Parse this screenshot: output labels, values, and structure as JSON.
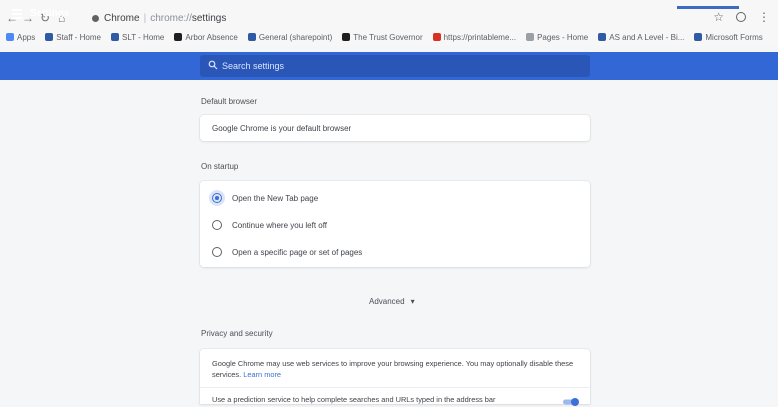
{
  "browser": {
    "omnibox": {
      "site_label": "Chrome",
      "url_dim": "chrome://",
      "url_path": "settings"
    },
    "bookmarks": [
      {
        "label": "Apps",
        "color": "#4c8bf5"
      },
      {
        "label": "Staff - Home",
        "color": "#2f5aa6"
      },
      {
        "label": "SLT - Home",
        "color": "#2f5aa6"
      },
      {
        "label": "Arbor Absence",
        "color": "#1f1f1f"
      },
      {
        "label": "General (sharepoint)",
        "color": "#2f5aa6"
      },
      {
        "label": "The Trust Governor",
        "color": "#1f1f1f"
      },
      {
        "label": "https://printableme...",
        "color": "#d93025"
      },
      {
        "label": "Pages - Home",
        "color": "#9aa0a6"
      },
      {
        "label": "AS and A Level - Bi...",
        "color": "#2f5aa6"
      },
      {
        "label": "Microsoft Forms",
        "color": "#2f5aa6"
      }
    ]
  },
  "header": {
    "title": "Settings",
    "search_placeholder": "Search settings",
    "color": "#3367d6"
  },
  "default_browser": {
    "section_title": "Default browser",
    "message": "Google Chrome is your default browser"
  },
  "on_startup": {
    "section_title": "On startup",
    "options": [
      {
        "label": "Open the New Tab page",
        "checked": true
      },
      {
        "label": "Continue where you left off",
        "checked": false
      },
      {
        "label": "Open a specific page or set of pages",
        "checked": false
      }
    ]
  },
  "advanced": {
    "label": "Advanced"
  },
  "privacy": {
    "section_title": "Privacy and security",
    "description": "Google Chrome may use web services to improve your browsing experience. You may optionally disable these",
    "description_line2": "services.",
    "learn_more": "Learn more",
    "prediction_text": "Use a prediction service to help complete searches and URLs typed in the address bar"
  }
}
